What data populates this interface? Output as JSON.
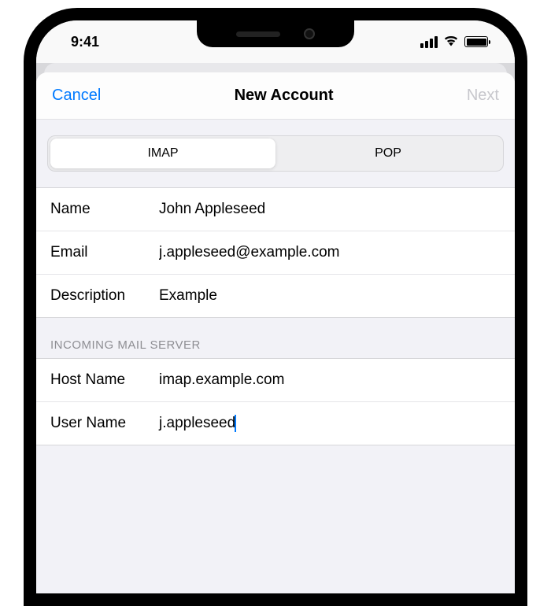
{
  "status": {
    "time": "9:41"
  },
  "nav": {
    "cancel": "Cancel",
    "title": "New Account",
    "next": "Next"
  },
  "segmented": {
    "imap": "IMAP",
    "pop": "POP"
  },
  "account": {
    "name_label": "Name",
    "name_value": "John Appleseed",
    "email_label": "Email",
    "email_value": "j.appleseed@example.com",
    "desc_label": "Description",
    "desc_value": "Example"
  },
  "incoming": {
    "header": "INCOMING MAIL SERVER",
    "host_label": "Host Name",
    "host_value": "imap.example.com",
    "user_label": "User Name",
    "user_value": "j.appleseed"
  }
}
